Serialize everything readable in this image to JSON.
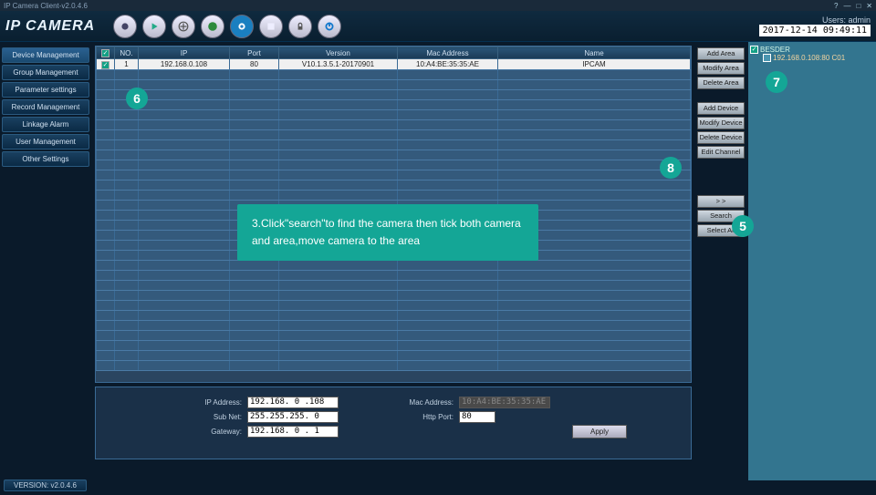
{
  "titlebar": {
    "title": "IP Camera Client-v2.0.4.6"
  },
  "logo": "IP CAMERA",
  "user_label": "Users: admin",
  "datetime": "2017-12-14 09:49:11",
  "sidebar": {
    "items": [
      "Device Management",
      "Group Management",
      "Parameter settings",
      "Record Management",
      "Linkage Alarm",
      "User Management",
      "Other Settings"
    ]
  },
  "version": "VERSION: v2.0.4.6",
  "table": {
    "headers": [
      "",
      "NO.",
      "IP",
      "Port",
      "Version",
      "Mac Address",
      "Name"
    ],
    "row": {
      "no": "1",
      "ip": "192.168.0.108",
      "port": "80",
      "version": "V10.1.3.5.1-20170901",
      "mac": "10:A4:BE:35:35:AE",
      "name": "IPCAM"
    }
  },
  "actions": {
    "add_area": "Add Area",
    "modify_area": "Modify Area",
    "delete_area": "Delete Area",
    "add_device": "Add Device",
    "modify_device": "Modify Device",
    "delete_device": "Delete Device",
    "edit_channel": "Edit Channel",
    "move": ">  >",
    "search": "Search",
    "select_all": "Select All"
  },
  "tree": {
    "area": "BESDER",
    "cam": "192.168.0.108:80 C01"
  },
  "net": {
    "ip_label": "IP Address:",
    "ip": "192.168. 0 .108",
    "subnet_label": "Sub Net:",
    "subnet": "255.255.255. 0",
    "gateway_label": "Gateway:",
    "gateway": "192.168. 0 . 1",
    "mac_label": "Mac Address:",
    "mac": "10:A4:BE:35:35:AE",
    "httpport_label": "Http Port:",
    "httpport": "80",
    "apply": "Apply"
  },
  "callout": "3.Click\"search\"to find the camera then tick both camera and area,move camera to the area",
  "badges": {
    "b5": "5",
    "b6": "6",
    "b7": "7",
    "b8": "8"
  }
}
